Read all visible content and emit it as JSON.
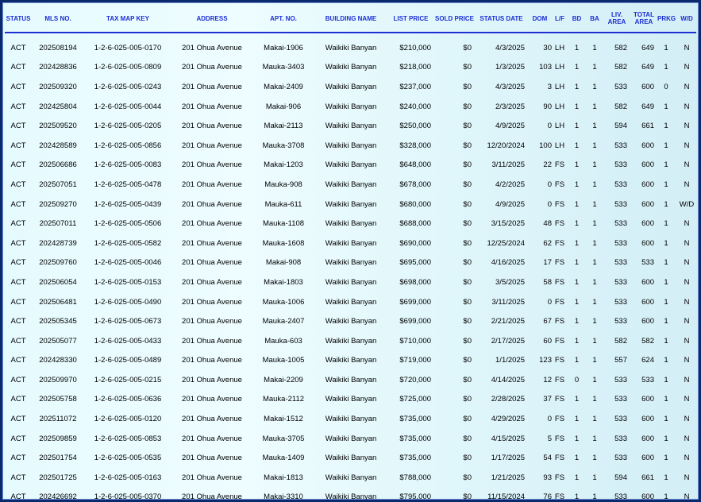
{
  "headers": {
    "status": "STATUS",
    "mls": "MLS NO.",
    "tmk": "TAX MAP KEY",
    "address": "ADDRESS",
    "apt": "APT. NO.",
    "building": "BUILDING NAME",
    "list_price": "LIST PRICE",
    "sold_price": "SOLD PRICE",
    "status_date": "STATUS DATE",
    "dom": "DOM",
    "lf": "L/F",
    "bd": "BD",
    "ba": "BA",
    "liv_area_1": "LIV.",
    "liv_area_2": "AREA",
    "total_area_1": "TOTAL",
    "total_area_2": "AREA",
    "prkg": "PRKG",
    "wd": "W/D"
  },
  "rows": [
    [
      "ACT",
      "202508194",
      "1-2-6-025-005-0170",
      "201 Ohua Avenue",
      "Makai-1906",
      "Waikiki Banyan",
      "$210,000",
      "$0",
      "4/3/2025",
      "30",
      "LH",
      "1",
      "1",
      "582",
      "649",
      "1",
      "N"
    ],
    [
      "ACT",
      "202428836",
      "1-2-6-025-005-0809",
      "201 Ohua Avenue",
      "Mauka-3403",
      "Waikiki Banyan",
      "$218,000",
      "$0",
      "1/3/2025",
      "103",
      "LH",
      "1",
      "1",
      "582",
      "649",
      "1",
      "N"
    ],
    [
      "ACT",
      "202509320",
      "1-2-6-025-005-0243",
      "201 Ohua Avenue",
      "Makai-2409",
      "Waikiki Banyan",
      "$237,000",
      "$0",
      "4/3/2025",
      "3",
      "LH",
      "1",
      "1",
      "533",
      "600",
      "0",
      "N"
    ],
    [
      "ACT",
      "202425804",
      "1-2-6-025-005-0044",
      "201 Ohua Avenue",
      "Makai-906",
      "Waikiki Banyan",
      "$240,000",
      "$0",
      "2/3/2025",
      "90",
      "LH",
      "1",
      "1",
      "582",
      "649",
      "1",
      "N"
    ],
    [
      "ACT",
      "202509520",
      "1-2-6-025-005-0205",
      "201 Ohua Avenue",
      "Makai-2113",
      "Waikiki Banyan",
      "$250,000",
      "$0",
      "4/9/2025",
      "0",
      "LH",
      "1",
      "1",
      "594",
      "661",
      "1",
      "N"
    ],
    [
      "ACT",
      "202428589",
      "1-2-6-025-005-0856",
      "201 Ohua Avenue",
      "Mauka-3708",
      "Waikiki Banyan",
      "$328,000",
      "$0",
      "12/20/2024",
      "100",
      "LH",
      "1",
      "1",
      "533",
      "600",
      "1",
      "N"
    ],
    [
      "ACT",
      "202506686",
      "1-2-6-025-005-0083",
      "201 Ohua Avenue",
      "Makai-1203",
      "Waikiki Banyan",
      "$648,000",
      "$0",
      "3/11/2025",
      "22",
      "FS",
      "1",
      "1",
      "533",
      "600",
      "1",
      "N"
    ],
    [
      "ACT",
      "202507051",
      "1-2-6-025-005-0478",
      "201 Ohua Avenue",
      "Mauka-908",
      "Waikiki Banyan",
      "$678,000",
      "$0",
      "4/2/2025",
      "0",
      "FS",
      "1",
      "1",
      "533",
      "600",
      "1",
      "N"
    ],
    [
      "ACT",
      "202509270",
      "1-2-6-025-005-0439",
      "201 Ohua Avenue",
      "Mauka-611",
      "Waikiki Banyan",
      "$680,000",
      "$0",
      "4/9/2025",
      "0",
      "FS",
      "1",
      "1",
      "533",
      "600",
      "1",
      "W/D"
    ],
    [
      "ACT",
      "202507011",
      "1-2-6-025-005-0506",
      "201 Ohua Avenue",
      "Mauka-1108",
      "Waikiki Banyan",
      "$688,000",
      "$0",
      "3/15/2025",
      "48",
      "FS",
      "1",
      "1",
      "533",
      "600",
      "1",
      "N"
    ],
    [
      "ACT",
      "202428739",
      "1-2-6-025-005-0582",
      "201 Ohua Avenue",
      "Mauka-1608",
      "Waikiki Banyan",
      "$690,000",
      "$0",
      "12/25/2024",
      "62",
      "FS",
      "1",
      "1",
      "533",
      "600",
      "1",
      "N"
    ],
    [
      "ACT",
      "202509760",
      "1-2-6-025-005-0046",
      "201 Ohua Avenue",
      "Makai-908",
      "Waikiki Banyan",
      "$695,000",
      "$0",
      "4/16/2025",
      "17",
      "FS",
      "1",
      "1",
      "533",
      "533",
      "1",
      "N"
    ],
    [
      "ACT",
      "202506054",
      "1-2-6-025-005-0153",
      "201 Ohua Avenue",
      "Makai-1803",
      "Waikiki Banyan",
      "$698,000",
      "$0",
      "3/5/2025",
      "58",
      "FS",
      "1",
      "1",
      "533",
      "600",
      "1",
      "N"
    ],
    [
      "ACT",
      "202506481",
      "1-2-6-025-005-0490",
      "201 Ohua Avenue",
      "Mauka-1006",
      "Waikiki Banyan",
      "$699,000",
      "$0",
      "3/11/2025",
      "0",
      "FS",
      "1",
      "1",
      "533",
      "600",
      "1",
      "N"
    ],
    [
      "ACT",
      "202505345",
      "1-2-6-025-005-0673",
      "201 Ohua Avenue",
      "Mauka-2407",
      "Waikiki Banyan",
      "$699,000",
      "$0",
      "2/21/2025",
      "67",
      "FS",
      "1",
      "1",
      "533",
      "600",
      "1",
      "N"
    ],
    [
      "ACT",
      "202505077",
      "1-2-6-025-005-0433",
      "201 Ohua Avenue",
      "Mauka-603",
      "Waikiki Banyan",
      "$710,000",
      "$0",
      "2/17/2025",
      "60",
      "FS",
      "1",
      "1",
      "582",
      "582",
      "1",
      "N"
    ],
    [
      "ACT",
      "202428330",
      "1-2-6-025-005-0489",
      "201 Ohua Avenue",
      "Mauka-1005",
      "Waikiki Banyan",
      "$719,000",
      "$0",
      "1/1/2025",
      "123",
      "FS",
      "1",
      "1",
      "557",
      "624",
      "1",
      "N"
    ],
    [
      "ACT",
      "202509970",
      "1-2-6-025-005-0215",
      "201 Ohua Avenue",
      "Makai-2209",
      "Waikiki Banyan",
      "$720,000",
      "$0",
      "4/14/2025",
      "12",
      "FS",
      "0",
      "1",
      "533",
      "533",
      "1",
      "N"
    ],
    [
      "ACT",
      "202505758",
      "1-2-6-025-005-0636",
      "201 Ohua Avenue",
      "Mauka-2112",
      "Waikiki Banyan",
      "$725,000",
      "$0",
      "2/28/2025",
      "37",
      "FS",
      "1",
      "1",
      "533",
      "600",
      "1",
      "N"
    ],
    [
      "ACT",
      "202511072",
      "1-2-6-025-005-0120",
      "201 Ohua Avenue",
      "Makai-1512",
      "Waikiki Banyan",
      "$735,000",
      "$0",
      "4/29/2025",
      "0",
      "FS",
      "1",
      "1",
      "533",
      "600",
      "1",
      "N"
    ],
    [
      "ACT",
      "202509859",
      "1-2-6-025-005-0853",
      "201 Ohua Avenue",
      "Mauka-3705",
      "Waikiki Banyan",
      "$735,000",
      "$0",
      "4/15/2025",
      "5",
      "FS",
      "1",
      "1",
      "533",
      "600",
      "1",
      "N"
    ],
    [
      "ACT",
      "202501754",
      "1-2-6-025-005-0535",
      "201 Ohua Avenue",
      "Mauka-1409",
      "Waikiki Banyan",
      "$735,000",
      "$0",
      "1/17/2025",
      "54",
      "FS",
      "1",
      "1",
      "533",
      "600",
      "1",
      "N"
    ],
    [
      "ACT",
      "202501725",
      "1-2-6-025-005-0163",
      "201 Ohua Avenue",
      "Makai-1813",
      "Waikiki Banyan",
      "$788,000",
      "$0",
      "1/21/2025",
      "93",
      "FS",
      "1",
      "1",
      "594",
      "661",
      "1",
      "N"
    ],
    [
      "ACT",
      "202426692",
      "1-2-6-025-005-0370",
      "201 Ohua Avenue",
      "Makai-3310",
      "Waikiki Banyan",
      "$795,000",
      "$0",
      "11/15/2024",
      "76",
      "FS",
      "1",
      "1",
      "533",
      "600",
      "1",
      "N"
    ]
  ]
}
